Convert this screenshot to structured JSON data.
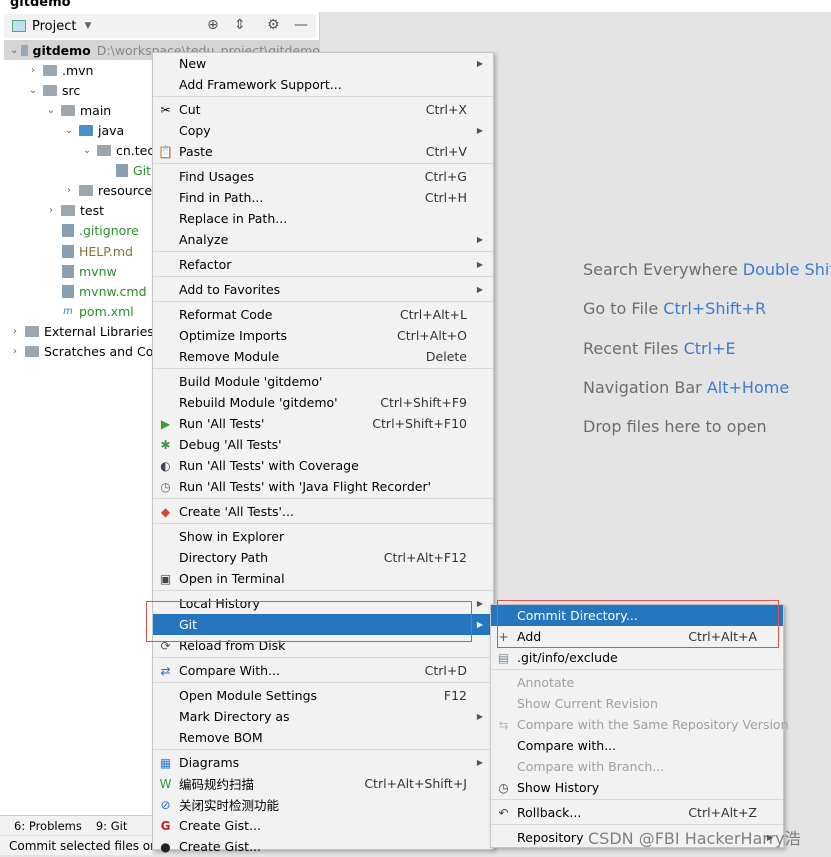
{
  "window": {
    "title": "gitdemo"
  },
  "project_panel": {
    "title": "Project",
    "tree": [
      {
        "label": "gitdemo",
        "path": "D:\\workspace\\tedu_project\\gitdemo",
        "indent": 0,
        "arrow": "down",
        "icon": "module",
        "bold": true
      },
      {
        "label": ".mvn",
        "indent": 1,
        "arrow": "right",
        "icon": "folder"
      },
      {
        "label": "src",
        "indent": 1,
        "arrow": "down",
        "icon": "folder"
      },
      {
        "label": "main",
        "indent": 2,
        "arrow": "down",
        "icon": "folder"
      },
      {
        "label": "java",
        "indent": 3,
        "arrow": "down",
        "icon": "folder-blue"
      },
      {
        "label": "cn.tec",
        "indent": 4,
        "arrow": "down",
        "icon": "package"
      },
      {
        "label": "Git",
        "indent": 5,
        "arrow": "",
        "icon": "class",
        "color": "#2d8c2d"
      },
      {
        "label": "resources",
        "indent": 3,
        "arrow": "right",
        "icon": "folder"
      },
      {
        "label": "test",
        "indent": 2,
        "arrow": "right",
        "icon": "folder"
      },
      {
        "label": ".gitignore",
        "indent": 2,
        "arrow": "",
        "icon": "file",
        "color": "#2d8c2d"
      },
      {
        "label": "HELP.md",
        "indent": 2,
        "arrow": "",
        "icon": "md",
        "color": "#8a6d3b"
      },
      {
        "label": "mvnw",
        "indent": 2,
        "arrow": "",
        "icon": "terminal",
        "color": "#2d8c2d"
      },
      {
        "label": "mvnw.cmd",
        "indent": 2,
        "arrow": "",
        "icon": "file",
        "color": "#2d8c2d"
      },
      {
        "label": "pom.xml",
        "indent": 2,
        "arrow": "",
        "icon": "maven",
        "color": "#2d8c2d"
      },
      {
        "label": "External Libraries",
        "indent": 0,
        "arrow": "right",
        "icon": "library"
      },
      {
        "label": "Scratches and Con",
        "indent": 0,
        "arrow": "right",
        "icon": "scratches"
      }
    ]
  },
  "editor_hints": [
    {
      "text": "Search Everywhere",
      "shortcut": "Double Shift"
    },
    {
      "text": "Go to File",
      "shortcut": "Ctrl+Shift+R"
    },
    {
      "text": "Recent Files",
      "shortcut": "Ctrl+E"
    },
    {
      "text": "Navigation Bar",
      "shortcut": "Alt+Home"
    },
    {
      "text": "Drop files here to open",
      "shortcut": ""
    }
  ],
  "context_menu": [
    {
      "label": "New",
      "sub": true
    },
    {
      "label": "Add Framework Support..."
    },
    {
      "sep": true
    },
    {
      "label": "Cut",
      "shortcut": "Ctrl+X",
      "icon": "scissors-icon",
      "glyph": "✂"
    },
    {
      "label": "Copy",
      "sub": true
    },
    {
      "label": "Paste",
      "shortcut": "Ctrl+V",
      "icon": "paste-icon",
      "glyph": "📋"
    },
    {
      "sep": true
    },
    {
      "label": "Find Usages",
      "shortcut": "Ctrl+G"
    },
    {
      "label": "Find in Path...",
      "shortcut": "Ctrl+H"
    },
    {
      "label": "Replace in Path..."
    },
    {
      "label": "Analyze",
      "sub": true
    },
    {
      "sep": true
    },
    {
      "label": "Refactor",
      "sub": true
    },
    {
      "sep": true
    },
    {
      "label": "Add to Favorites",
      "sub": true
    },
    {
      "sep": true
    },
    {
      "label": "Reformat Code",
      "shortcut": "Ctrl+Alt+L"
    },
    {
      "label": "Optimize Imports",
      "shortcut": "Ctrl+Alt+O"
    },
    {
      "label": "Remove Module",
      "shortcut": "Delete"
    },
    {
      "sep": true
    },
    {
      "label": "Build Module 'gitdemo'"
    },
    {
      "label": "Rebuild Module 'gitdemo'",
      "shortcut": "Ctrl+Shift+F9"
    },
    {
      "label": "Run 'All Tests'",
      "shortcut": "Ctrl+Shift+F10",
      "icon": "run-icon",
      "glyph": "▶",
      "color": "#3c9a3c"
    },
    {
      "label": "Debug 'All Tests'",
      "icon": "debug-icon",
      "glyph": "✱",
      "color": "#3c9a3c"
    },
    {
      "label": "Run 'All Tests' with Coverage",
      "icon": "coverage-icon",
      "glyph": "◐",
      "color": "#446"
    },
    {
      "label": "Run 'All Tests' with 'Java Flight Recorder'",
      "icon": "profiler-icon",
      "glyph": "◷",
      "color": "#666"
    },
    {
      "sep": true
    },
    {
      "label": "Create 'All Tests'...",
      "icon": "create-test-icon",
      "glyph": "◆",
      "color": "#d04a2a"
    },
    {
      "sep": true
    },
    {
      "label": "Show in Explorer"
    },
    {
      "label": "Directory Path",
      "shortcut": "Ctrl+Alt+F12"
    },
    {
      "label": "Open in Terminal",
      "icon": "terminal-icon",
      "glyph": "▣",
      "color": "#444"
    },
    {
      "sep": true
    },
    {
      "label": "Local History",
      "sub": true
    },
    {
      "label": "Git",
      "sub": true,
      "highlighted": true
    },
    {
      "label": "Reload from Disk",
      "icon": "reload-icon",
      "glyph": "⟳",
      "color": "#555"
    },
    {
      "sep": true
    },
    {
      "label": "Compare With...",
      "shortcut": "Ctrl+D",
      "icon": "compare-icon",
      "glyph": "⇄",
      "color": "#2a6fc9"
    },
    {
      "sep": true
    },
    {
      "label": "Open Module Settings",
      "shortcut": "F12"
    },
    {
      "label": "Mark Directory as",
      "sub": true
    },
    {
      "label": "Remove BOM"
    },
    {
      "sep": true
    },
    {
      "label": "Diagrams",
      "sub": true,
      "icon": "diagram-icon",
      "glyph": "▦",
      "color": "#3a7bc8"
    },
    {
      "label": "编码规约扫描",
      "shortcut": "Ctrl+Alt+Shift+J",
      "icon": "scan-icon",
      "glyph": "W",
      "color": "#2d9a3a"
    },
    {
      "label": "关闭实时检测功能",
      "icon": "disable-icon",
      "glyph": "⊘",
      "color": "#2a6fc9"
    },
    {
      "label": "Create Gist...",
      "icon": "gitee-icon",
      "glyph": "G",
      "color": "#c71d23"
    },
    {
      "label": "Create Gist...",
      "icon": "github-icon",
      "glyph": "●",
      "color": "#222"
    }
  ],
  "git_submenu": [
    {
      "label": "Commit Directory...",
      "highlighted": true
    },
    {
      "label": "Add",
      "shortcut": "Ctrl+Alt+A",
      "icon": "plus-icon",
      "glyph": "+",
      "color": "#555"
    },
    {
      "label": ".git/info/exclude",
      "icon": "exclude-file-icon",
      "glyph": "▤",
      "color": "#7a8a99"
    },
    {
      "sep": true
    },
    {
      "label": "Annotate",
      "disabled": true
    },
    {
      "label": "Show Current Revision",
      "disabled": true
    },
    {
      "label": "Compare with the Same Repository Version",
      "disabled": true,
      "icon": "compare-icon",
      "glyph": "⇆",
      "color": "#bbb"
    },
    {
      "label": "Compare with..."
    },
    {
      "label": "Compare with Branch...",
      "disabled": true
    },
    {
      "label": "Show History",
      "icon": "clock-icon",
      "glyph": "◷",
      "color": "#444"
    },
    {
      "sep": true
    },
    {
      "label": "Rollback...",
      "shortcut": "Ctrl+Alt+Z",
      "icon": "rollback-icon",
      "glyph": "↶",
      "color": "#444"
    },
    {
      "sep": true
    },
    {
      "label": "Repository",
      "sub": true
    }
  ],
  "bottom_tabs": [
    {
      "label": "6: Problems"
    },
    {
      "label": "9: Git"
    }
  ],
  "status": "Commit selected files or directories",
  "watermark": "CSDN @FBI HackerHarry浩",
  "colors": {
    "highlight": "#2675bf",
    "hint_shortcut": "#3b7bd4",
    "annotation_box": "#e05050"
  }
}
